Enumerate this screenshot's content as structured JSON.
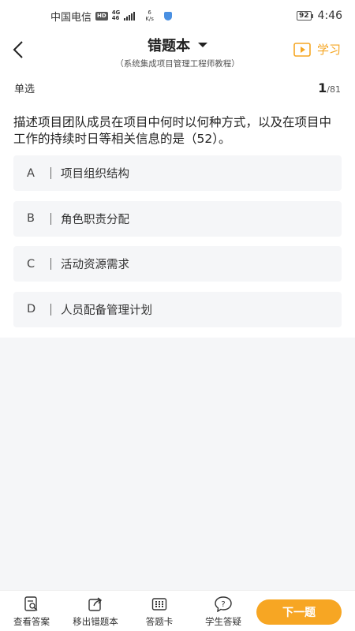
{
  "status_bar": {
    "carrier": "中国电信",
    "hd": "HD",
    "net_top": "4G",
    "net_bottom": "46",
    "speed_value": "6",
    "speed_unit": "K/s",
    "battery": "92",
    "time": "4:46"
  },
  "header": {
    "title": "错题本",
    "subtitle": "（系统集成项目管理工程师教程）",
    "study_label": "学习",
    "accent_color": "#f5a623"
  },
  "question": {
    "type": "单选",
    "current": "1",
    "total": "/81",
    "text": "描述项目团队成员在项目中何时以何种方式，以及在项目中工作的持续时日等相关信息的是（52）。",
    "options": [
      {
        "key": "A",
        "text": "项目组织结构"
      },
      {
        "key": "B",
        "text": "角色职责分配"
      },
      {
        "key": "C",
        "text": "活动资源需求"
      },
      {
        "key": "D",
        "text": "人员配备管理计划"
      }
    ]
  },
  "bottom_bar": {
    "tabs": [
      {
        "label": "查看答案",
        "icon": "view-answer-icon"
      },
      {
        "label": "移出错题本",
        "icon": "move-out-icon"
      },
      {
        "label": "答题卡",
        "icon": "answer-card-icon"
      },
      {
        "label": "学生答疑",
        "icon": "question-help-icon"
      }
    ],
    "next_label": "下一题",
    "next_color": "#f7a623"
  }
}
